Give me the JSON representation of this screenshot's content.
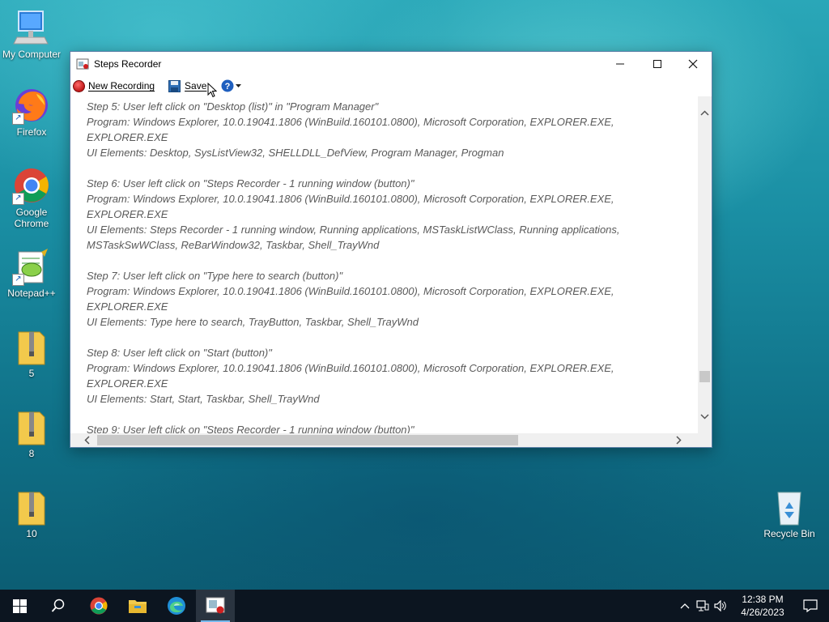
{
  "desktop": {
    "icons": [
      {
        "label": "My Computer"
      },
      {
        "label": "Firefox"
      },
      {
        "label": "Google Chrome"
      },
      {
        "label": "Notepad++"
      },
      {
        "label": "5"
      },
      {
        "label": "8"
      },
      {
        "label": "10"
      },
      {
        "label": "Recycle Bin"
      }
    ]
  },
  "window": {
    "title": "Steps Recorder",
    "toolbar": {
      "new_recording": "New Recording",
      "save": "Save"
    },
    "steps": [
      {
        "header": "Step 5: User left click on \"Desktop (list)\" in \"Program Manager\"",
        "program": "Program: Windows Explorer, 10.0.19041.1806 (WinBuild.160101.0800), Microsoft Corporation, EXPLORER.EXE,",
        "program_cont": "EXPLORER.EXE",
        "ui": "UI Elements: Desktop, SysListView32, SHELLDLL_DefView, Program Manager, Progman",
        "ui_cont": ""
      },
      {
        "header": "Step 6: User left click on \"Steps Recorder - 1 running window (button)\"",
        "program": "Program: Windows Explorer, 10.0.19041.1806 (WinBuild.160101.0800), Microsoft Corporation, EXPLORER.EXE,",
        "program_cont": "EXPLORER.EXE",
        "ui": "UI Elements: Steps Recorder - 1 running window, Running applications, MSTaskListWClass, Running applications,",
        "ui_cont": "MSTaskSwWClass, ReBarWindow32, Taskbar, Shell_TrayWnd"
      },
      {
        "header": "Step 7: User left click on \"Type here to search (button)\"",
        "program": "Program: Windows Explorer, 10.0.19041.1806 (WinBuild.160101.0800), Microsoft Corporation, EXPLORER.EXE,",
        "program_cont": "EXPLORER.EXE",
        "ui": "UI Elements: Type here to search, TrayButton, Taskbar, Shell_TrayWnd",
        "ui_cont": ""
      },
      {
        "header": "Step 8: User left click on \"Start (button)\"",
        "program": "Program: Windows Explorer, 10.0.19041.1806 (WinBuild.160101.0800), Microsoft Corporation, EXPLORER.EXE,",
        "program_cont": "EXPLORER.EXE",
        "ui": "UI Elements: Start, Start, Taskbar, Shell_TrayWnd",
        "ui_cont": ""
      },
      {
        "header": "Step 9: User left click on \"Steps Recorder - 1 running window (button)\"",
        "program": "",
        "program_cont": "",
        "ui": "",
        "ui_cont": ""
      }
    ]
  },
  "taskbar": {
    "time": "12:38 PM",
    "date": "4/26/2023"
  },
  "colors": {
    "taskbar_bg": "#0c1520",
    "accent": "#76b9ed",
    "record_red": "#c01818"
  }
}
